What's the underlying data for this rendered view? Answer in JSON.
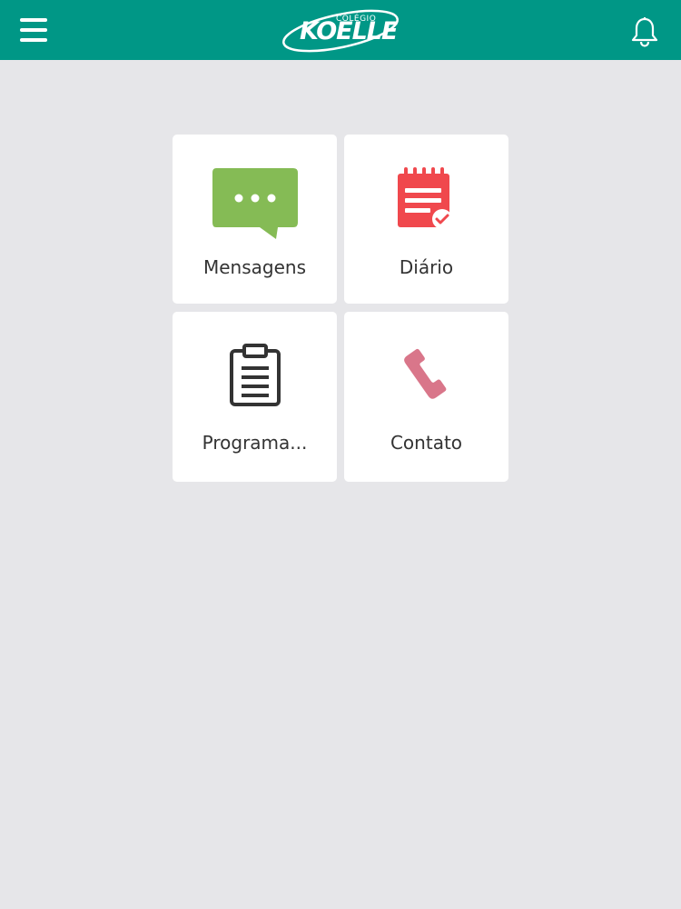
{
  "header": {
    "logo_sub": "COLÉGIO",
    "logo_main": "KOELLE",
    "menu_icon": "hamburger-menu-icon",
    "notification_icon": "bell-icon"
  },
  "colors": {
    "header_bg": "#009786",
    "page_bg": "#e6e6e9",
    "messages_icon": "#85bb55",
    "diary_icon": "#f0484d",
    "program_icon": "#333333",
    "contact_icon": "#d9768a"
  },
  "tiles": [
    {
      "label": "Mensagens",
      "icon": "chat-bubble-icon"
    },
    {
      "label": "Diário",
      "icon": "notepad-check-icon"
    },
    {
      "label": "Programa...",
      "icon": "clipboard-icon"
    },
    {
      "label": "Contato",
      "icon": "phone-icon"
    }
  ]
}
